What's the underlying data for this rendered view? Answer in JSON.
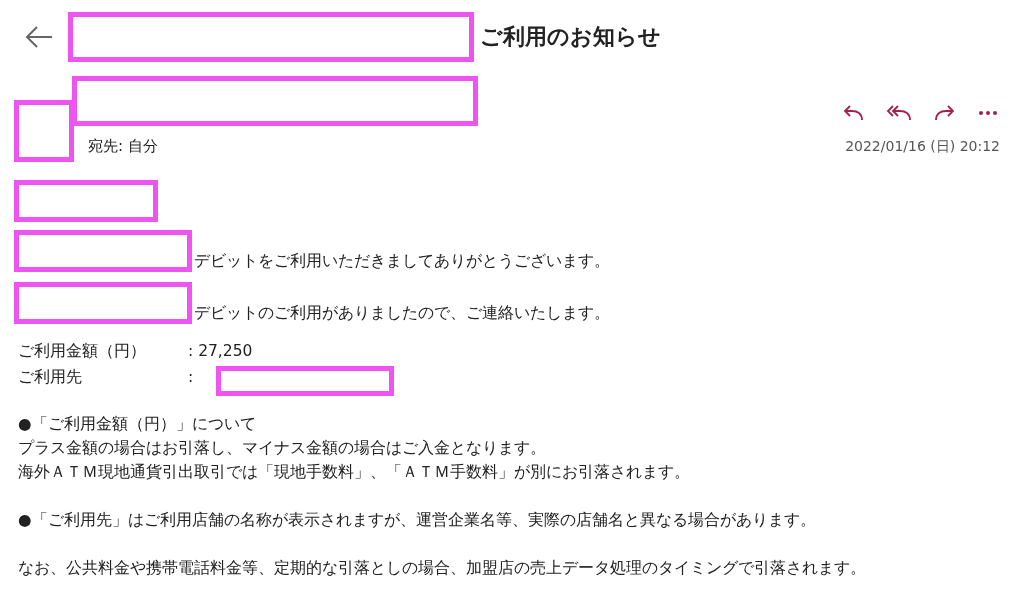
{
  "header": {
    "title": "ご利用のお知らせ"
  },
  "message": {
    "recipient": "宛先:  自分",
    "date": "2022/01/16 (日) 20:12"
  },
  "intro_lines": [
    "デビットをご利用いただきましてありがとうございます。",
    "デビットのご利用がありましたので、ご連絡いたします。"
  ],
  "details": [
    {
      "label": "ご利用金額（円）",
      "value": ": 27,250",
      "redacted": false
    },
    {
      "label": "ご利用先",
      "value": ":",
      "redacted": true
    }
  ],
  "paragraphs": [
    [
      "●「ご利用金額（円）」について",
      "プラス金額の場合はお引落し、マイナス金額の場合はご入金となります。",
      "海外ＡＴＭ現地通貨引出取引では「現地手数料」、「ＡＴＭ手数料」が別にお引落されます。"
    ],
    [
      "●「ご利用先」はご利用店舗の名称が表示されますが、運営企業名等、実際の店舗名と異なる場合があります。"
    ],
    [
      "なお、公共料金や携帯電話料金等、定期的な引落としの場合、加盟店の売上データ処理のタイミングで引落されます。"
    ]
  ]
}
